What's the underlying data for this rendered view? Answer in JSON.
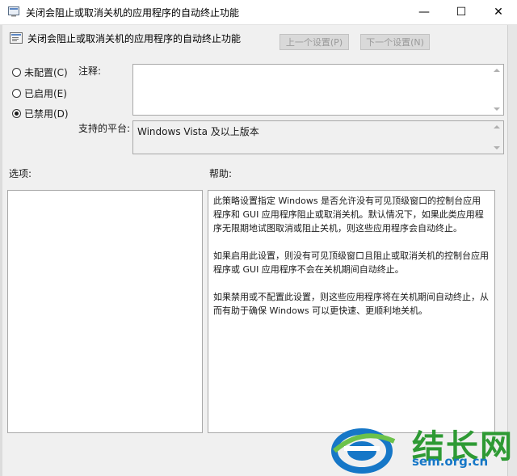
{
  "window": {
    "title": "关闭会阻止或取消关机的应用程序的自动终止功能",
    "minimize_glyph": "—",
    "maximize_glyph": "☐",
    "close_glyph": "✕"
  },
  "header": {
    "policy_title": "关闭会阻止或取消关机的应用程序的自动终止功能",
    "prev_button": "上一个设置(P)",
    "next_button": "下一个设置(N)"
  },
  "options": [
    {
      "label": "未配置(C)",
      "checked": false
    },
    {
      "label": "已启用(E)",
      "checked": false
    },
    {
      "label": "已禁用(D)",
      "checked": true
    }
  ],
  "comment": {
    "label": "注释:",
    "value": ""
  },
  "platform": {
    "label": "支持的平台:",
    "value": "Windows Vista 及以上版本"
  },
  "sections": {
    "options_label": "选项:",
    "help_label": "帮助:"
  },
  "help": {
    "p1": "此策略设置指定 Windows 是否允许没有可见顶级窗口的控制台应用程序和 GUI 应用程序阻止或取消关机。默认情况下，如果此类应用程序无限期地试图取消或阻止关机，则这些应用程序会自动终止。",
    "p2": "如果启用此设置，则没有可见顶级窗口且阻止或取消关机的控制台应用程序或 GUI 应用程序不会在关机期间自动终止。",
    "p3": "如果禁用或不配置此设置，则这些应用程序将在关机期间自动终止，从而有助于确保 Windows 可以更快速、更顺利地关机。"
  },
  "watermark": {
    "brand": "结长网",
    "url": "sem.org.cn"
  },
  "colors": {
    "watermark_green": "#2e9a34",
    "watermark_blue": "#1677c7"
  }
}
